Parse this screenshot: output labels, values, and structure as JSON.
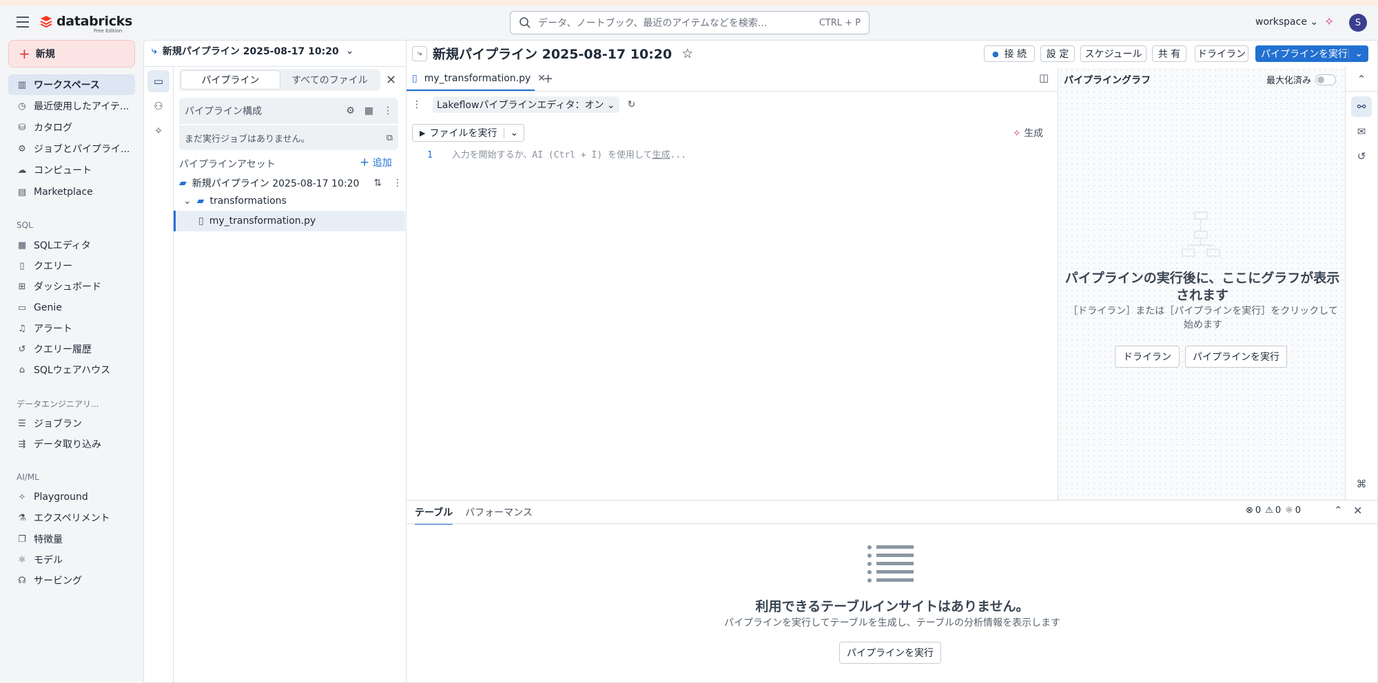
{
  "app": {
    "brand": "databricks",
    "edition": "Free Edition"
  },
  "search": {
    "placeholder": "データ、ノートブック、最近のアイテムなどを検索...",
    "shortcut": "CTRL + P"
  },
  "account": {
    "workspace": "workspace",
    "avatar_initial": "S"
  },
  "sidebar": {
    "new_label": "新規",
    "items": [
      {
        "label": "ワークスペース",
        "icon": "workspace-icon"
      },
      {
        "label": "最近使用したアイテ...",
        "icon": "clock-icon"
      },
      {
        "label": "カタログ",
        "icon": "catalog-icon"
      },
      {
        "label": "ジョブとパイプライ...",
        "icon": "jobs-icon"
      },
      {
        "label": "コンピュート",
        "icon": "cloud-icon"
      },
      {
        "label": "Marketplace",
        "icon": "store-icon"
      }
    ],
    "sql_section": "SQL",
    "sql_items": [
      {
        "label": "SQLエディタ",
        "icon": "editor-icon"
      },
      {
        "label": "クエリー",
        "icon": "query-icon"
      },
      {
        "label": "ダッシュボード",
        "icon": "dashboard-icon"
      },
      {
        "label": "Genie",
        "icon": "genie-icon"
      },
      {
        "label": "アラート",
        "icon": "bell-icon"
      },
      {
        "label": "クエリー履歴",
        "icon": "history-icon"
      },
      {
        "label": "SQLウェアハウス",
        "icon": "warehouse-icon"
      }
    ],
    "de_section": "データエンジニアリ...",
    "de_items": [
      {
        "label": "ジョブラン",
        "icon": "jobruns-icon"
      },
      {
        "label": "データ取り込み",
        "icon": "ingest-icon"
      }
    ],
    "ai_section": "AI/ML",
    "ai_items": [
      {
        "label": "Playground",
        "icon": "playground-icon"
      },
      {
        "label": "エクスペリメント",
        "icon": "flask-icon"
      },
      {
        "label": "特徴量",
        "icon": "features-icon"
      },
      {
        "label": "モデル",
        "icon": "model-icon"
      },
      {
        "label": "サービング",
        "icon": "serving-icon"
      }
    ]
  },
  "pipeline_panel": {
    "title": "新規パイプライン 2025-08-17 10:20",
    "tab_pipeline": "パイプライン",
    "tab_all_files": "すべてのファイル",
    "config_label": "パイプライン構成",
    "no_jobs": "まだ実行ジョブはありません。",
    "assets_label": "パイプラインアセット",
    "add_label": "追加",
    "tree": {
      "root": "新規パイプライン 2025-08-17 10:20",
      "folder": "transformations",
      "file": "my_transformation.py"
    }
  },
  "editor": {
    "title": "新規パイプライン 2025-08-17 10:20",
    "buttons": {
      "connect": "接 続",
      "settings": "設 定",
      "schedule": "スケジュール",
      "share": "共 有",
      "dry_run": "ドライラン",
      "run": "パイプラインを実行"
    },
    "file_tab": "my_transformation.py",
    "lakeflow": "Lakeflowパイプラインエディタ：オン",
    "run_file": "ファイルを実行",
    "generate": "生成",
    "line_number": "1",
    "code_hint_prefix": "入力を開始するか、AI (Ctrl + I) を使用して",
    "code_hint_link": "生成",
    "code_hint_suffix": "..."
  },
  "graph": {
    "title": "パイプライングラフ",
    "maximized_label": "最大化済み",
    "message": "パイプラインの実行後に、ここにグラフが表示されます",
    "sub": "［ドライラン］または［パイプラインを実行］をクリックして始めます",
    "dry_run": "ドライラン",
    "run": "パイプラインを実行"
  },
  "bottom": {
    "tab_table": "テーブル",
    "tab_perf": "パフォーマンス",
    "errors": "0",
    "warnings": "0",
    "hints": "0",
    "empty_title": "利用できるテーブルインサイトはありません。",
    "empty_sub": "パイプラインを実行してテーブルを生成し、テーブルの分析情報を表示します",
    "run": "パイプラインを実行"
  }
}
